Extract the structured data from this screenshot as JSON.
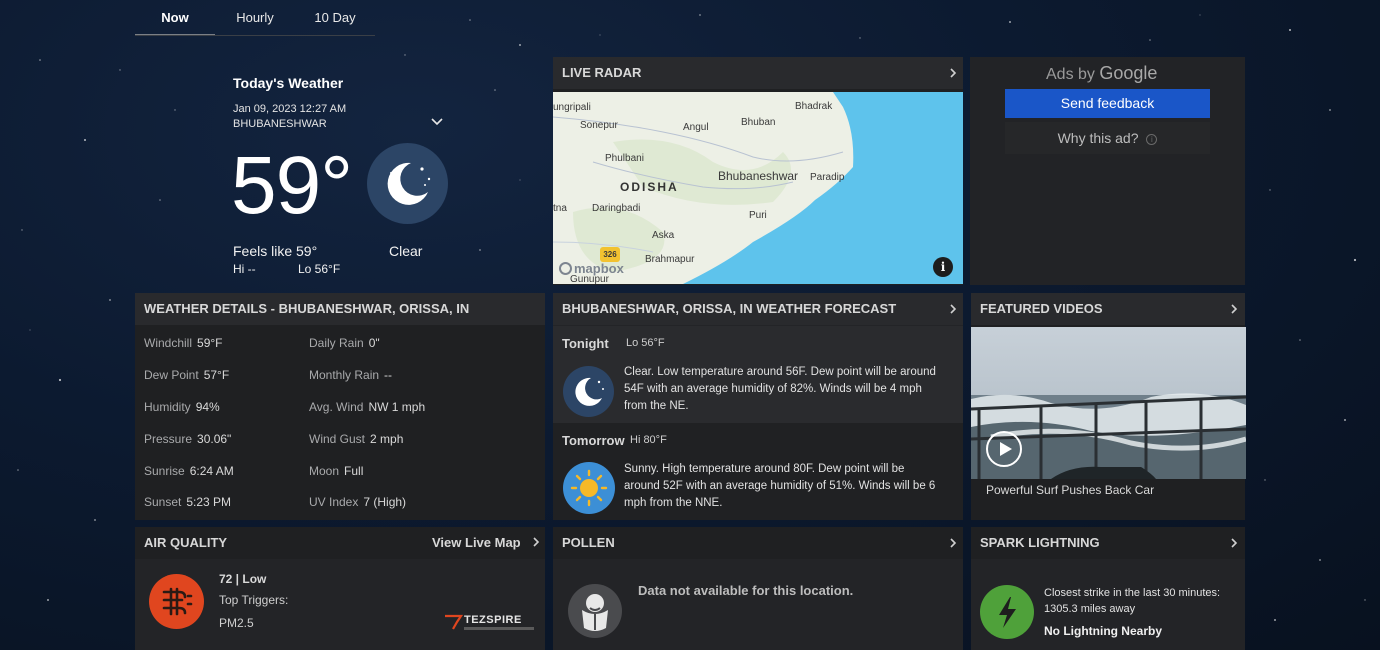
{
  "tabs": [
    {
      "label": "Now",
      "active": true
    },
    {
      "label": "Hourly",
      "active": false
    },
    {
      "label": "10 Day",
      "active": false
    }
  ],
  "today": {
    "title": "Today's Weather",
    "datetime": "Jan 09, 2023 12:27 AM",
    "location": "BHUBANESHWAR",
    "temperature": "59°",
    "icon": "moon-stars-icon",
    "feels_like": "Feels like 59°",
    "condition": "Clear",
    "hi": "Hi --",
    "lo": "Lo 56°F"
  },
  "live_radar": {
    "title": "LIVE RADAR",
    "map_labels": {
      "state": "ODISHA",
      "places": [
        "ungripali",
        "Sonepur",
        "Angul",
        "Bhuban",
        "Bhadrak",
        "Phulbani",
        "Bhubaneshwar",
        "Paradip",
        "Daringbadi",
        "Puri",
        "tna",
        "Aska",
        "Brahmapur",
        "Gunupur"
      ],
      "road_shield": "326",
      "attribution": "mapbox"
    }
  },
  "ads": {
    "ads_by": "Ads by",
    "google": "Google",
    "send_feedback": "Send feedback",
    "why_this_ad": "Why this ad?"
  },
  "weather_details": {
    "title": "WEATHER DETAILS - BHUBANESHWAR, ORISSA, IN",
    "left": [
      {
        "label": "Windchill",
        "value": "59°F"
      },
      {
        "label": "Dew Point",
        "value": "57°F"
      },
      {
        "label": "Humidity",
        "value": "94%"
      },
      {
        "label": "Pressure",
        "value": "30.06\""
      },
      {
        "label": "Sunrise",
        "value": "6:24 AM"
      },
      {
        "label": "Sunset",
        "value": "5:23 PM"
      }
    ],
    "right": [
      {
        "label": "Daily Rain",
        "value": "0\""
      },
      {
        "label": "Monthly Rain",
        "value": "--"
      },
      {
        "label": "Avg. Wind",
        "value": "NW 1 mph"
      },
      {
        "label": "Wind Gust",
        "value": "2 mph"
      },
      {
        "label": "Moon",
        "value": "Full"
      },
      {
        "label": "UV Index",
        "value": "7 (High)"
      }
    ]
  },
  "forecast": {
    "title": "BHUBANESHWAR, ORISSA, IN WEATHER FORECAST",
    "periods": [
      {
        "name": "Tonight",
        "temp": "Lo 56°F",
        "icon": "moon-icon",
        "text_lines": [
          "Clear. Low temperature around 56F. Dew point will be around",
          "54F with an average humidity of 82%. Winds will be 4 mph",
          "from the NE."
        ]
      },
      {
        "name": "Tomorrow",
        "temp": "Hi 80°F",
        "icon": "sun-icon",
        "text_lines": [
          "Sunny. High temperature around 80F. Dew point will be",
          "around 52F with an average humidity of 51%. Winds will be 6",
          "mph from the NNE."
        ]
      }
    ]
  },
  "featured_videos": {
    "title": "FEATURED VIDEOS",
    "caption": "Powerful Surf Pushes Back Car"
  },
  "air_quality": {
    "title": "AIR QUALITY",
    "link": "View Live Map",
    "value": "72 | Low",
    "triggers_label": "Top Triggers:",
    "trigger": "PM2.5",
    "sponsor": "TEZSPIRE"
  },
  "pollen": {
    "title": "POLLEN",
    "message": "Data not available for this location."
  },
  "spark_lightning": {
    "title": "SPARK LIGHTNING",
    "closest": "Closest strike in the last 30 minutes:",
    "distance": "1305.3 miles away",
    "status": "No Lightning Nearby"
  },
  "colors": {
    "card_bg": "#1f2022",
    "card_header": "#292a2d",
    "feedback_blue": "#1a56c8",
    "air_quality_orange": "#e0461f",
    "sun_blue": "#3c8fd6",
    "sun_yellow": "#f6b928",
    "lightning_green": "#4fa13a",
    "map_water": "#5ec3ec"
  }
}
